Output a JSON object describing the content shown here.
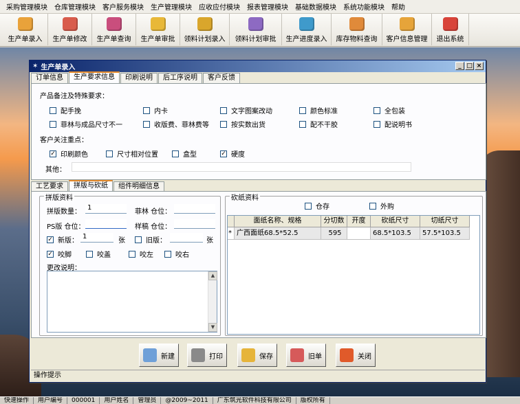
{
  "menu": [
    "采购管理模块",
    "仓库管理模块",
    "客户服务模块",
    "生产管理模块",
    "应收应付模块",
    "报表管理模块",
    "基础数据模块",
    "系统功能模块",
    "帮助"
  ],
  "toolbar": [
    {
      "label": "生产单录入",
      "icon": "box-icon",
      "color": "#e9a23a"
    },
    {
      "label": "生产单修改",
      "icon": "edit-icon",
      "color": "#d85c4c"
    },
    {
      "label": "生产单查询",
      "icon": "search-icon",
      "color": "#c94e7d"
    },
    {
      "label": "生产单审批",
      "icon": "approve-icon",
      "color": "#e8b838"
    },
    {
      "label": "领料计划录入",
      "icon": "pencil-icon",
      "color": "#d9a62c"
    },
    {
      "label": "领料计划审批",
      "icon": "stack-icon",
      "color": "#8d6ac2"
    },
    {
      "label": "生产进度录入",
      "icon": "progress-icon",
      "color": "#3f9acb"
    },
    {
      "label": "库存物料查询",
      "icon": "inventory-icon",
      "color": "#e08a3a"
    },
    {
      "label": "客户信息管理",
      "icon": "customer-icon",
      "color": "#e6a43a"
    },
    {
      "label": "退出系统",
      "icon": "exit-icon",
      "color": "#d8443a"
    }
  ],
  "window": {
    "title": "生产单录入",
    "controls": [
      "_",
      "□",
      "×"
    ]
  },
  "top_tabs": [
    "订单信息",
    "生产要求信息",
    "印刷说明",
    "后工序说明",
    "客户反馈"
  ],
  "product_notes": {
    "heading": "产品备注及特殊要求：",
    "items": [
      {
        "label": "配手挽",
        "checked": false
      },
      {
        "label": "内卡",
        "checked": false
      },
      {
        "label": "文字图案改动",
        "checked": false
      },
      {
        "label": "颜色标准",
        "checked": false
      },
      {
        "label": "全包装",
        "checked": false
      },
      {
        "label": "菲林与成品尺寸不一",
        "checked": false
      },
      {
        "label": "收版费、菲林费等",
        "checked": false
      },
      {
        "label": "按实数出货",
        "checked": false
      },
      {
        "label": "配不干胶",
        "checked": false
      },
      {
        "label": "配说明书",
        "checked": false
      }
    ]
  },
  "customer_focus": {
    "heading": "客户关注重点：",
    "items": [
      {
        "label": "印刷颜色",
        "checked": true
      },
      {
        "label": "尺寸相对位置",
        "checked": false
      },
      {
        "label": "盒型",
        "checked": false
      },
      {
        "label": "硬度",
        "checked": true
      }
    ],
    "other_label": "其他：",
    "other_value": ""
  },
  "sub_tabs": [
    "工艺要求",
    "拼版与砍纸",
    "组件明细信息"
  ],
  "imposition": {
    "title": "拼版资料",
    "count_label": "拼版数量：",
    "count_value": "1",
    "film_label": "菲林 仓位：",
    "film_value": "",
    "ps_label": "PS版 仓位：",
    "ps_value": "",
    "sample_label": "样稿 仓位：",
    "sample_value": "",
    "new_label": "新版：",
    "new_checked": true,
    "new_value": "1",
    "unit1": "张",
    "old_label": "旧版：",
    "old_checked": false,
    "old_value": "",
    "unit2": "张",
    "options": [
      {
        "label": "咬脚",
        "checked": true
      },
      {
        "label": "咬盖",
        "checked": false
      },
      {
        "label": "咬左",
        "checked": false
      },
      {
        "label": "咬右",
        "checked": false
      }
    ],
    "change_label": "更改说明：",
    "change_value": ""
  },
  "cutting": {
    "title": "砍纸资料",
    "warehouse_label": "仓存",
    "warehouse_checked": false,
    "outsource_label": "外购",
    "outsource_checked": false,
    "columns": [
      "面纸名称、规格",
      "分切数",
      "开度",
      "砍纸尺寸",
      "切纸尺寸"
    ],
    "rows": [
      {
        "marker": "*",
        "name": "广西面纸68.5*52.5",
        "cut": "595",
        "open": "",
        "paper_size": "68.5*103.5",
        "cut_size": "57.5*103.5"
      }
    ]
  },
  "buttons": [
    {
      "label": "新建",
      "icon": "new-doc-icon",
      "color": "#6fa0d8"
    },
    {
      "label": "打印",
      "icon": "printer-icon",
      "color": "#8a8a8a"
    },
    {
      "label": "保存",
      "icon": "save-icon",
      "color": "#e6b43a"
    },
    {
      "label": "旧单",
      "icon": "old-order-icon",
      "color": "#d65a5a"
    },
    {
      "label": "关闭",
      "icon": "close-icon",
      "color": "#e05a2a"
    }
  ],
  "op_hint": "操作提示",
  "status": [
    "快速操作",
    "用户编号",
    "000001",
    "用户姓名",
    "管理员",
    "@2009~2011",
    "广东筑光软件科技有限公司",
    "版权所有"
  ]
}
